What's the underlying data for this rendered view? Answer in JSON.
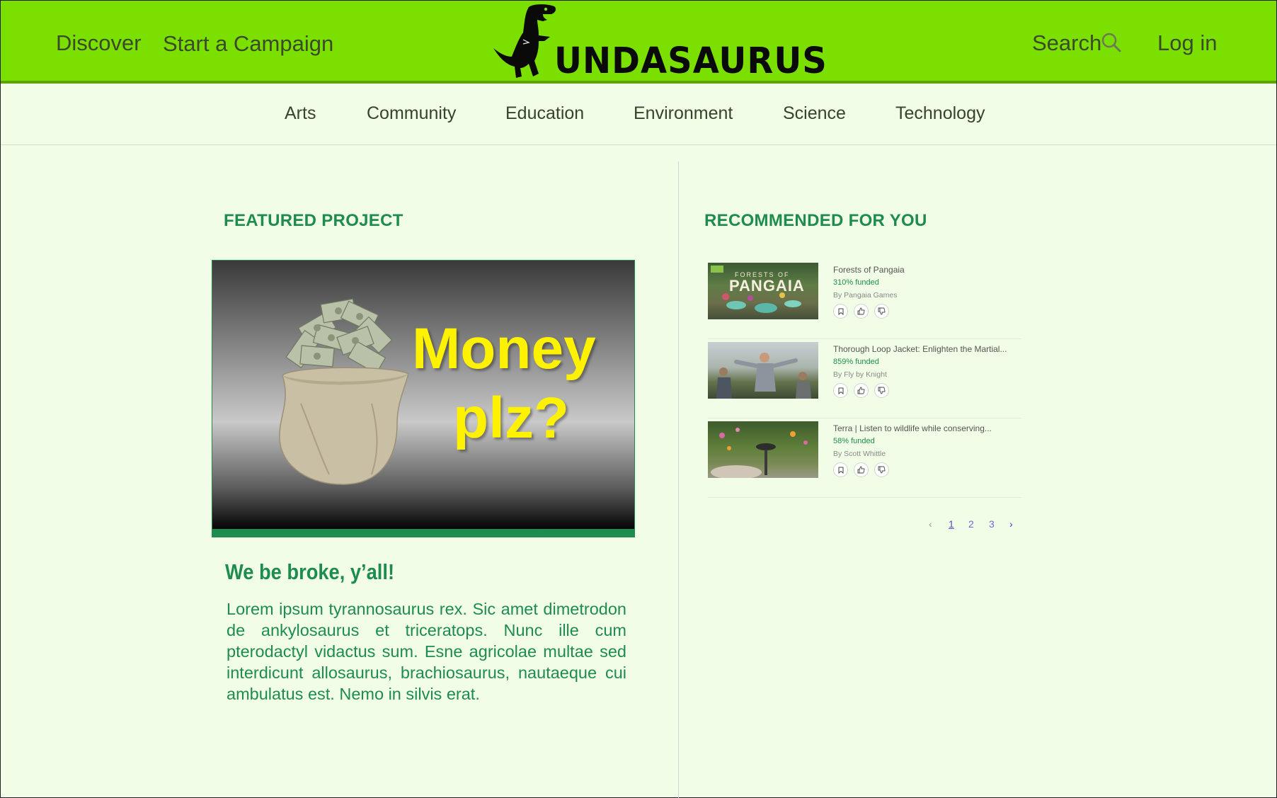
{
  "header": {
    "nav_discover": "Discover",
    "nav_start_campaign": "Start a Campaign",
    "search_label": "Search",
    "login_label": "Log in",
    "logo_text": "UNDASAURUS"
  },
  "categories": [
    "Arts",
    "Community",
    "Education",
    "Environment",
    "Science",
    "Technology"
  ],
  "featured": {
    "heading": "FEATURED PROJECT",
    "image_text_line1": "Money",
    "image_text_line2": "plz?",
    "title": "We be broke, y’all!",
    "description": "Lorem ipsum tyrannosaurus rex.  Sic amet dimetrodon de ankylosaurus et triceratops.  Nunc ille cum pterodactyl vidactus sum.  Esne agricolae multae sed interdicunt allosaurus, brachiosaurus, nautaeque cui ambulatus est.  Nemo in silvis erat."
  },
  "recommended": {
    "heading": "RECOMMENDED FOR YOU",
    "items": [
      {
        "title": "Forests of Pangaia",
        "funded": "310% funded",
        "by": "By Pangaia Games",
        "thumb_text": "PANGAIA",
        "thumb_subtext": "FORESTS OF"
      },
      {
        "title": "Thorough Loop Jacket: Enlighten the Martial...",
        "funded": "859% funded",
        "by": "By Fly by Knight"
      },
      {
        "title": "Terra | Listen to wildlife while conserving...",
        "funded": "58% funded",
        "by": "By Scott Whittle"
      }
    ],
    "pager": {
      "prev": "‹",
      "pages": [
        "1",
        "2",
        "3"
      ],
      "next": "›",
      "current": "1"
    }
  },
  "colors": {
    "header_green": "#7be000",
    "brand_green": "#1e8c4e",
    "background": "#f1fde6",
    "money_yellow": "#fff200"
  },
  "icons": {
    "search": "magnifier-icon",
    "bookmark": "bookmark-icon",
    "like": "thumbs-up-icon",
    "dislike": "thumbs-down-icon"
  }
}
